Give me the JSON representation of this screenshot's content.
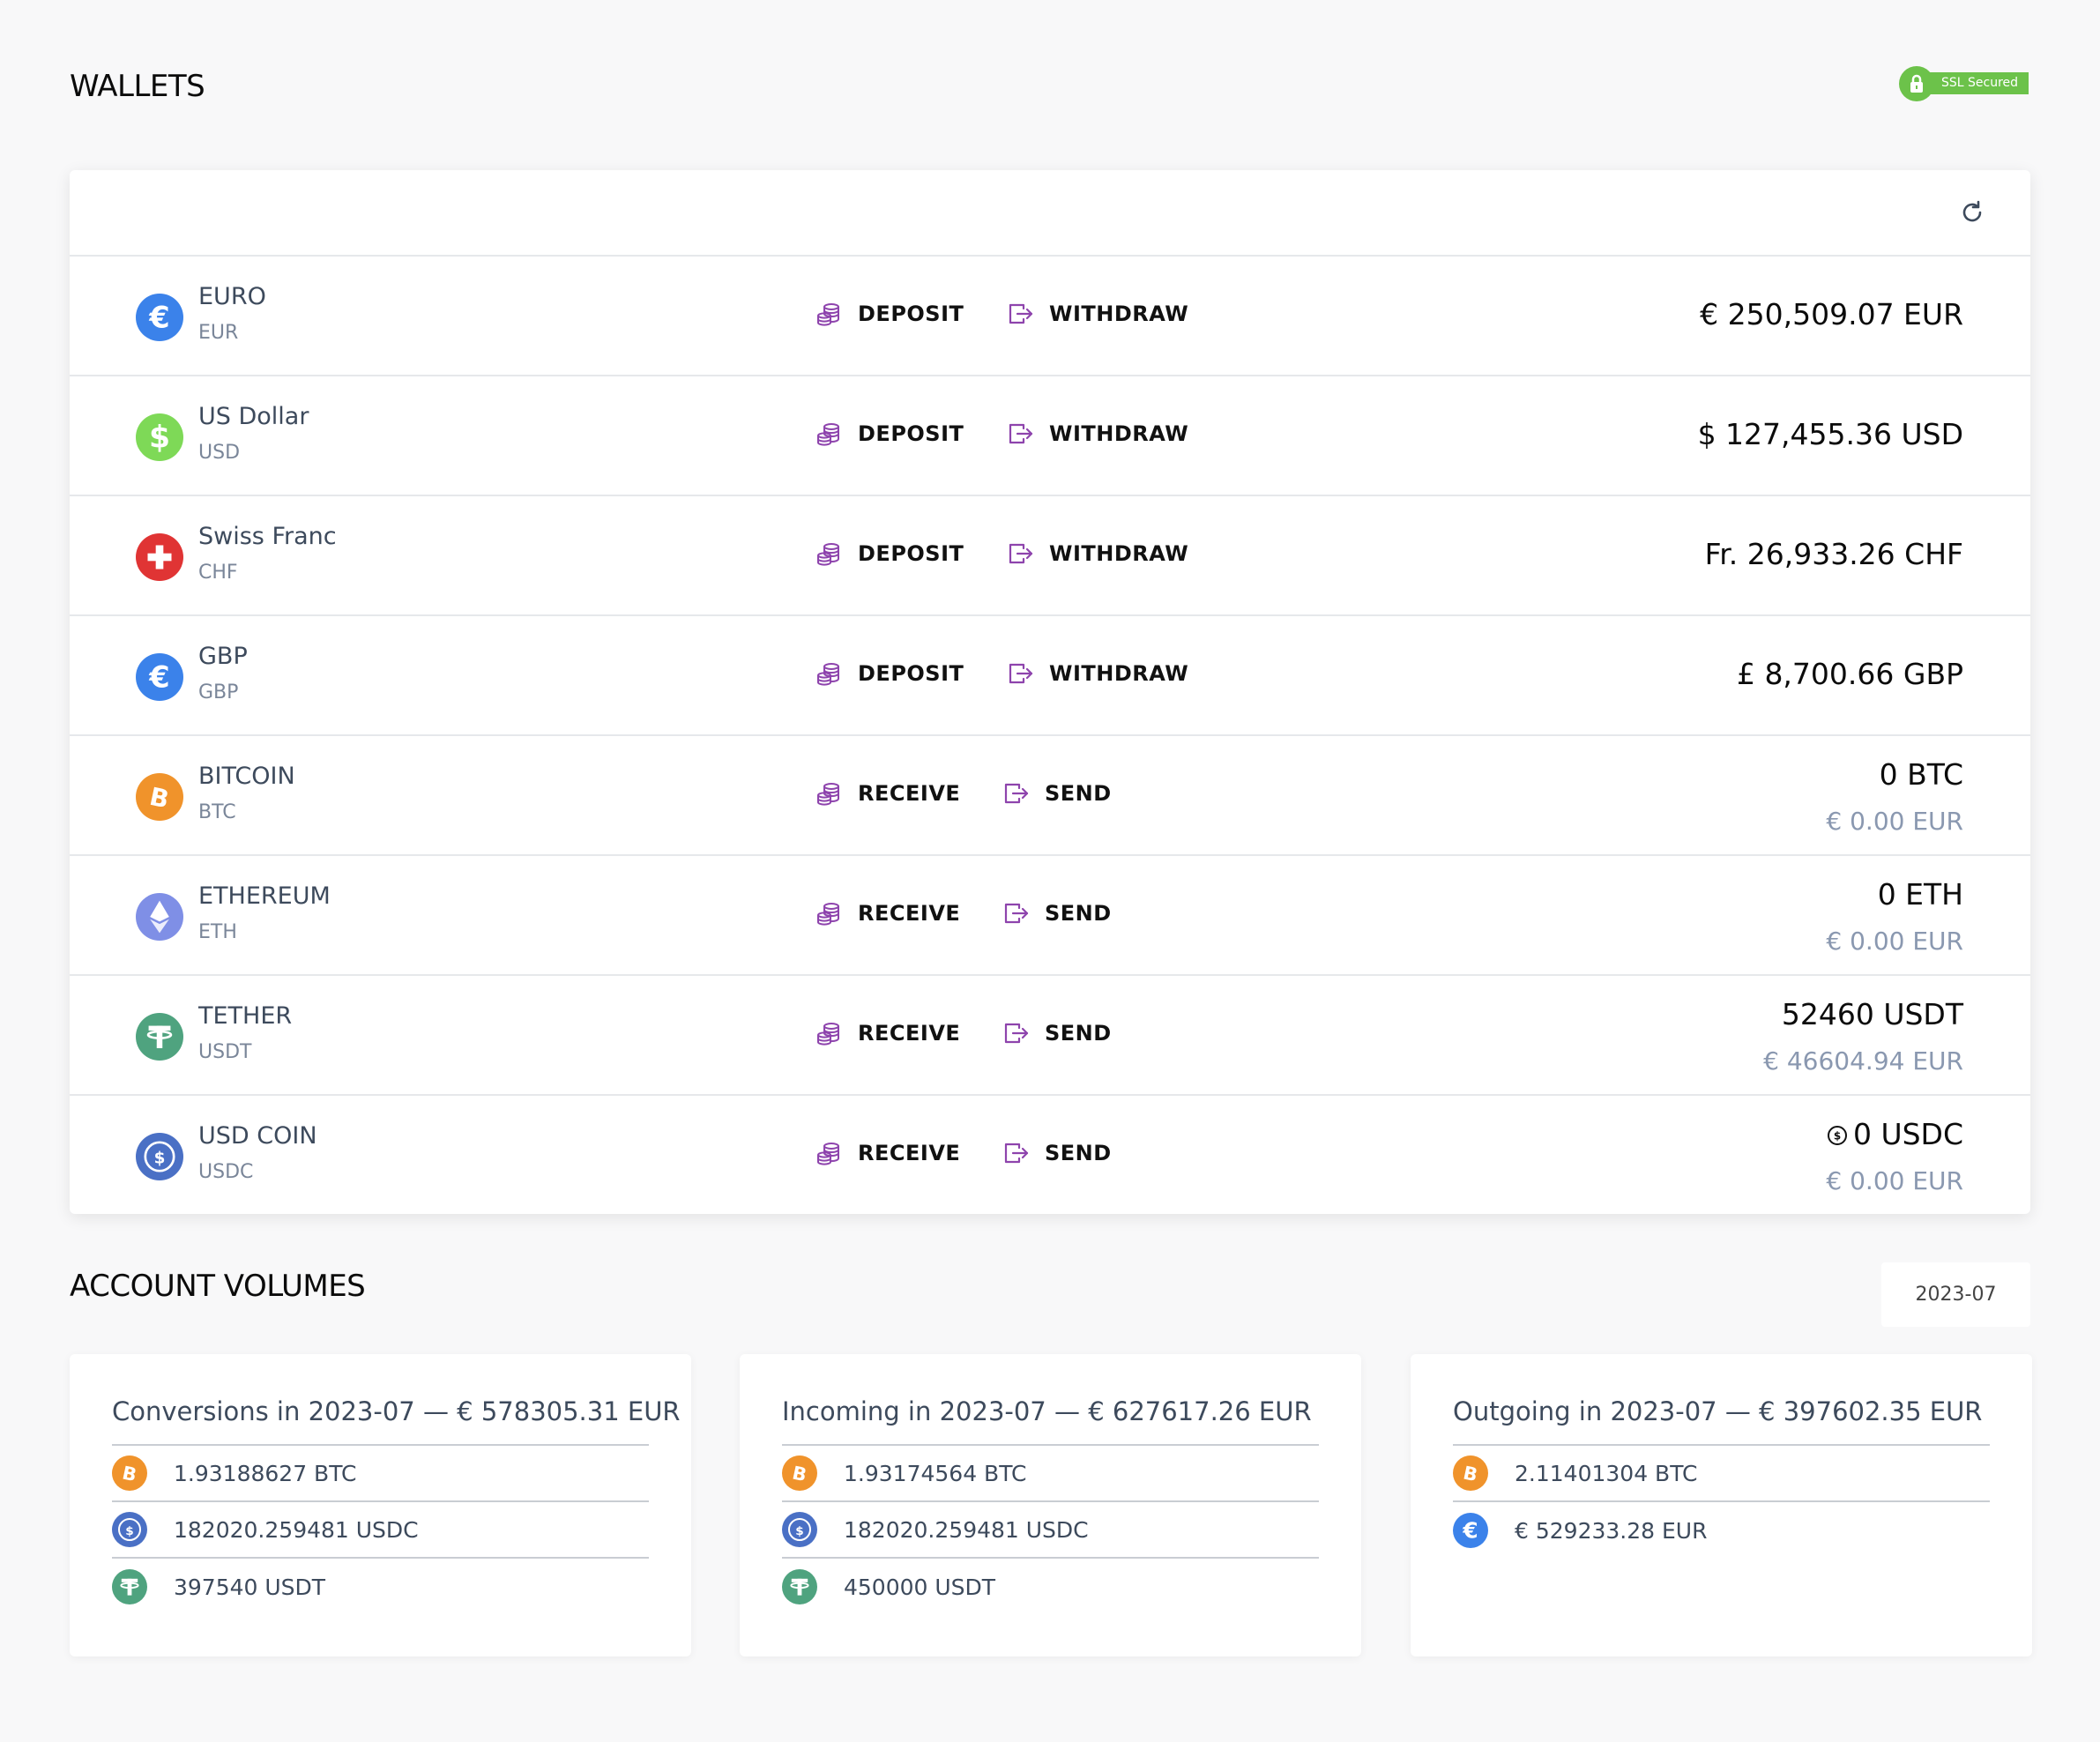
{
  "wallets_title": "WALLETS",
  "ssl_badge": "SSL Secured",
  "colors": {
    "euro": "#3b82ea",
    "usd": "#7ed957",
    "chf": "#e03434",
    "btc": "#f0932b",
    "eth": "#7f8fe6",
    "usdt": "#4fa37f",
    "usdc": "#4a70c5",
    "action_icon": "#8e44ad",
    "ssl": "#6cc24a"
  },
  "wallets": [
    {
      "name": "EURO",
      "code": "EUR",
      "icon": "euro-icon",
      "action1": "DEPOSIT",
      "action2": "WITHDRAW",
      "balance": "€ 250,509.07 EUR",
      "balance_eur": ""
    },
    {
      "name": "US Dollar",
      "code": "USD",
      "icon": "dollar-icon",
      "action1": "DEPOSIT",
      "action2": "WITHDRAW",
      "balance": "$ 127,455.36 USD",
      "balance_eur": ""
    },
    {
      "name": "Swiss Franc",
      "code": "CHF",
      "icon": "swiss-cross-icon",
      "action1": "DEPOSIT",
      "action2": "WITHDRAW",
      "balance": "Fr. 26,933.26 CHF",
      "balance_eur": ""
    },
    {
      "name": "GBP",
      "code": "GBP",
      "icon": "euro-icon",
      "action1": "DEPOSIT",
      "action2": "WITHDRAW",
      "balance": "£ 8,700.66 GBP",
      "balance_eur": ""
    },
    {
      "name": "BITCOIN",
      "code": "BTC",
      "icon": "bitcoin-icon",
      "action1": "RECEIVE",
      "action2": "SEND",
      "balance": "0 BTC",
      "balance_eur": "€ 0.00 EUR"
    },
    {
      "name": "ETHEREUM",
      "code": "ETH",
      "icon": "ethereum-icon",
      "action1": "RECEIVE",
      "action2": "SEND",
      "balance": "0 ETH",
      "balance_eur": "€ 0.00 EUR"
    },
    {
      "name": "TETHER",
      "code": "USDT",
      "icon": "tether-icon",
      "action1": "RECEIVE",
      "action2": "SEND",
      "balance": "52460 USDT",
      "balance_eur": "€ 46604.94 EUR"
    },
    {
      "name": "USD COIN",
      "code": "USDC",
      "icon": "usdc-icon",
      "action1": "RECEIVE",
      "action2": "SEND",
      "balance": "0 USDC",
      "balance_eur": "€ 0.00 EUR"
    }
  ],
  "volumes_title": "ACCOUNT VOLUMES",
  "period": "2023-07",
  "volumes": [
    {
      "title": "Conversions in 2023-07 — € 578305.31 EUR",
      "items": [
        {
          "icon": "bitcoin-icon",
          "value": "1.93188627 BTC"
        },
        {
          "icon": "usdc-icon",
          "value": "182020.259481 USDC"
        },
        {
          "icon": "tether-icon",
          "value": "397540 USDT"
        }
      ]
    },
    {
      "title": "Incoming in 2023-07 — € 627617.26 EUR",
      "items": [
        {
          "icon": "bitcoin-icon",
          "value": "1.93174564 BTC"
        },
        {
          "icon": "usdc-icon",
          "value": "182020.259481 USDC"
        },
        {
          "icon": "tether-icon",
          "value": "450000 USDT"
        }
      ]
    },
    {
      "title": "Outgoing in 2023-07 — € 397602.35 EUR",
      "items": [
        {
          "icon": "bitcoin-icon",
          "value": "2.11401304 BTC"
        },
        {
          "icon": "euro-icon",
          "value": "€ 529233.28 EUR"
        }
      ]
    }
  ]
}
